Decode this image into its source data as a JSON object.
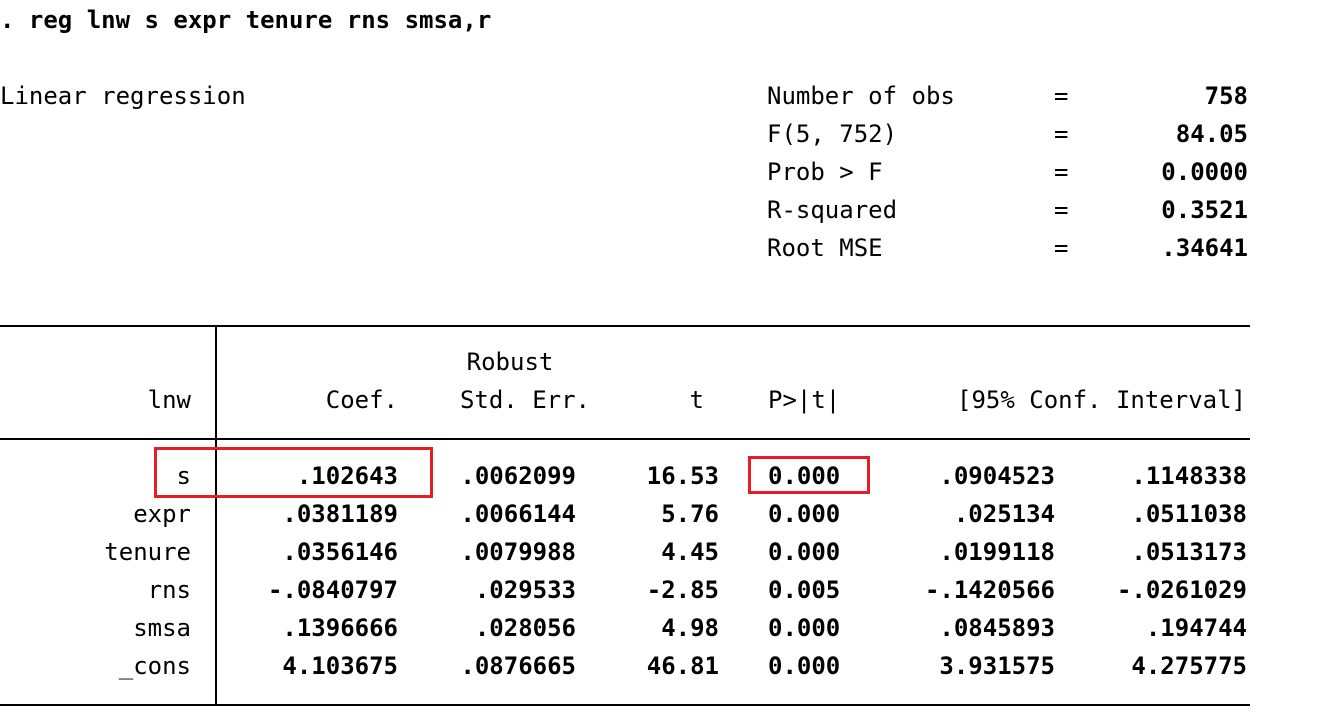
{
  "command": ". reg lnw s expr tenure rns smsa,r",
  "model_title": "Linear regression",
  "stats": [
    {
      "label": "Number of obs",
      "eq": "=",
      "value": "758"
    },
    {
      "label": "F(5, 752)",
      "eq": "=",
      "value": "84.05"
    },
    {
      "label": "Prob > F",
      "eq": "=",
      "value": "0.0000"
    },
    {
      "label": "R-squared",
      "eq": "=",
      "value": "0.3521"
    },
    {
      "label": "Root MSE",
      "eq": "=",
      "value": ".34641"
    }
  ],
  "table": {
    "dep_var": "lnw",
    "header_top": "Robust",
    "headers": [
      "Coef.",
      "Std. Err.",
      "t",
      "P>|t|",
      "[95% Conf. Interval]"
    ],
    "rows": [
      {
        "var": "s",
        "coef": ".102643",
        "se": ".0062099",
        "t": "16.53",
        "p": "0.000",
        "ci_lo": ".0904523",
        "ci_hi": ".1148338"
      },
      {
        "var": "expr",
        "coef": ".0381189",
        "se": ".0066144",
        "t": "5.76",
        "p": "0.000",
        "ci_lo": ".025134",
        "ci_hi": ".0511038"
      },
      {
        "var": "tenure",
        "coef": ".0356146",
        "se": ".0079988",
        "t": "4.45",
        "p": "0.000",
        "ci_lo": ".0199118",
        "ci_hi": ".0513173"
      },
      {
        "var": "rns",
        "coef": "-.0840797",
        "se": ".029533",
        "t": "-2.85",
        "p": "0.005",
        "ci_lo": "-.1420566",
        "ci_hi": "-.0261029"
      },
      {
        "var": "smsa",
        "coef": ".1396666",
        "se": ".028056",
        "t": "4.98",
        "p": "0.000",
        "ci_lo": ".0845893",
        "ci_hi": ".194744"
      },
      {
        "var": "_cons",
        "coef": "4.103675",
        "se": ".0876665",
        "t": "46.81",
        "p": "0.000",
        "ci_lo": "3.931575",
        "ci_hi": "4.275775"
      }
    ]
  },
  "highlight_color": "#e31e24"
}
